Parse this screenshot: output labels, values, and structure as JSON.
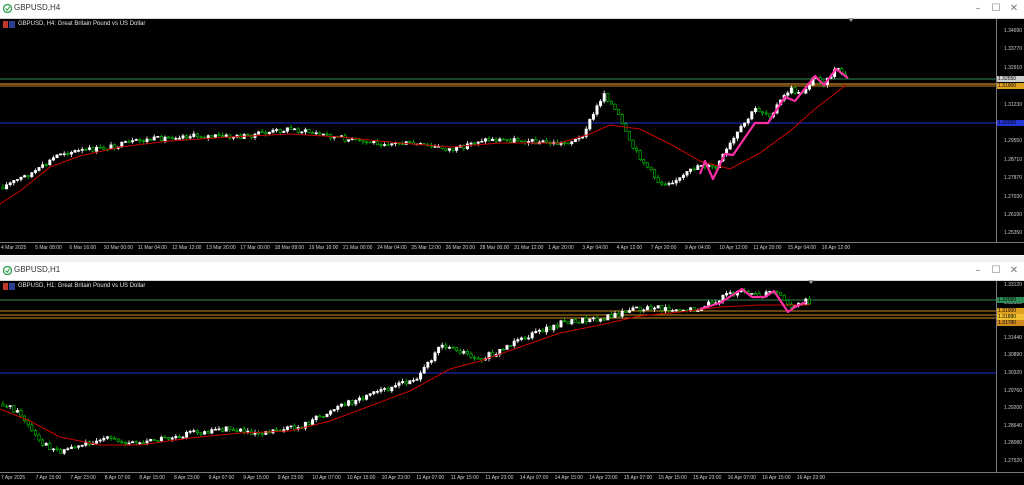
{
  "windows": [
    {
      "title": "GBPUSD,H4",
      "chart_label": "GBPUSD, H4:  Great Britain Pound vs US Dollar",
      "y_ticks": [
        "1.34690",
        "1.33770",
        "1.32910",
        "1.32050",
        "1.31230",
        "1.30390",
        "1.29550",
        "1.28710",
        "1.27870",
        "1.27030",
        "1.26190",
        "1.25350"
      ],
      "x_ticks": [
        "4 Mar 2025",
        "5 Mar 08:00",
        "6 Mar 16:00",
        "10 Mar 00:00",
        "11 Mar 04:00",
        "12 Mar 12:00",
        "13 Mar 20:00",
        "17 Mar 00:00",
        "18 Mar 08:00",
        "19 Mar 16:00",
        "21 Mar 00:00",
        "24 Mar 04:00",
        "25 Mar 12:00",
        "26 Mar 20:00",
        "28 Mar 00:00",
        "31 Mar 12:00",
        "1 Apr 20:00",
        "3 Apr 04:00",
        "4 Apr 12:00",
        "7 Apr 20:00",
        "9 Apr 04:00",
        "10 Apr 12:00",
        "11 Apr 20:00",
        "15 Apr 04:00",
        "16 Apr 12:00"
      ],
      "price_labels": [
        "1.32550",
        "1.31900",
        "1.30390"
      ]
    },
    {
      "title": "GBPUSD,H1",
      "chart_label": "GBPUSD, H1:  Great Britain Pound vs US Dollar",
      "y_ticks": [
        "1.33120",
        "1.32550",
        "1.31900",
        "1.31440",
        "1.30890",
        "1.30320",
        "1.29760",
        "1.29200",
        "1.28640",
        "1.28080",
        "1.27520"
      ],
      "x_ticks": [
        "7 Apr 2025",
        "7 Apr 15:00",
        "7 Apr 23:00",
        "8 Apr 07:00",
        "8 Apr 15:00",
        "8 Apr 23:00",
        "9 Apr 07:00",
        "9 Apr 15:00",
        "9 Apr 23:00",
        "10 Apr 07:00",
        "10 Apr 15:00",
        "10 Apr 23:00",
        "11 Apr 07:00",
        "11 Apr 15:00",
        "11 Apr 23:00",
        "14 Apr 07:00",
        "14 Apr 15:00",
        "14 Apr 23:00",
        "15 Apr 07:00",
        "15 Apr 15:00",
        "15 Apr 23:00",
        "16 Apr 07:00",
        "16 Apr 15:00",
        "16 Apr 23:00"
      ],
      "price_labels": [
        "1.32550",
        "1.31900",
        "1.31880",
        "1.31780"
      ]
    }
  ],
  "colors": {
    "bull": "#ffffff",
    "bear": "#00cc00",
    "ma": "#cc0000",
    "pattern": "#ff2ea6",
    "hline_green": "#2e8b57",
    "hline_orange": "#c8861e",
    "hline_blue": "#1f2fd6"
  },
  "icons": {
    "app": "chart-window-icon",
    "minimize": "minimize-icon",
    "maximize": "maximize-icon",
    "close": "close-icon"
  }
}
